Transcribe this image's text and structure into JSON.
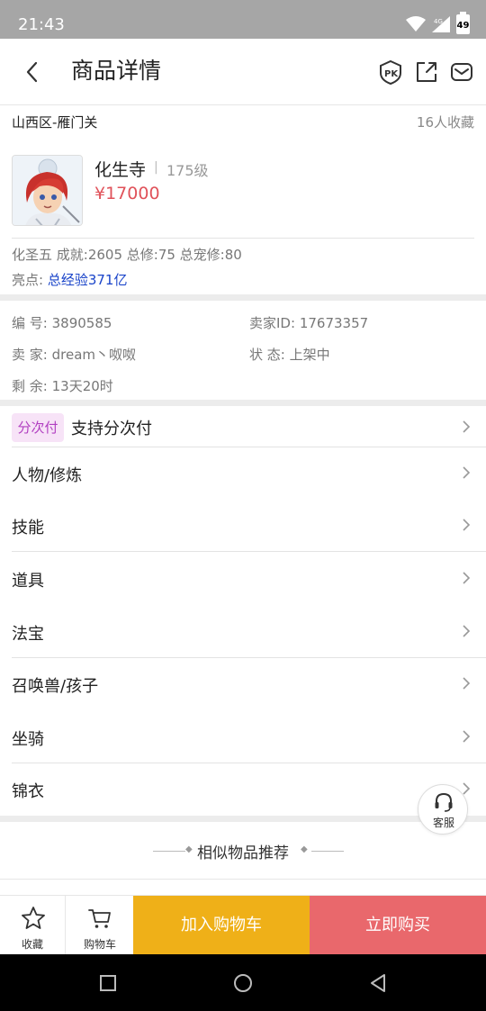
{
  "status_bar": {
    "time": "21:43",
    "network": "4G",
    "battery": "49"
  },
  "header": {
    "title": "商品详情"
  },
  "region": {
    "name": "山西区-雁门关",
    "favorites": "16人收藏"
  },
  "product": {
    "name": "化生寺",
    "level": "175级",
    "price": "¥17000",
    "stats": "化圣五 成就:2605 总修:75 总宠修:80",
    "highlight_label": "亮点:",
    "highlight_value": "总经验371亿"
  },
  "info": {
    "id_label": "编 号:",
    "id_value": "3890585",
    "seller_id_label": "卖家ID:",
    "seller_id_value": "17673357",
    "seller_label": "卖 家:",
    "seller_value": "dream丶呶呶",
    "status_label": "状 态:",
    "status_value": "上架中",
    "remaining_label": "剩 余:",
    "remaining_value": "13天20时"
  },
  "installment": {
    "badge": "分次付",
    "label": "支持分次付"
  },
  "sections": [
    {
      "label": "人物/修炼"
    },
    {
      "label": "技能"
    },
    {
      "label": "道具"
    },
    {
      "label": "法宝"
    },
    {
      "label": "召唤兽/孩子"
    },
    {
      "label": "坐骑"
    },
    {
      "label": "锦衣"
    }
  ],
  "customer_service": {
    "label": "客服"
  },
  "recommend": {
    "title": "相似物品推荐"
  },
  "bottom_bar": {
    "favorite": "收藏",
    "cart": "购物车",
    "add_to_cart": "加入购物车",
    "buy_now": "立即购买"
  },
  "colors": {
    "price": "#e0525a",
    "highlight": "#1a44c9",
    "add_to_cart_bg": "#efb018",
    "buy_now_bg": "#e9686c",
    "installment_badge_bg": "#f7e3f7",
    "installment_badge_text": "#b13fc1"
  },
  "icons": [
    "back-icon",
    "pk-icon",
    "share-icon",
    "mail-icon",
    "chevron-right-icon",
    "headset-icon",
    "star-icon",
    "cart-icon"
  ]
}
